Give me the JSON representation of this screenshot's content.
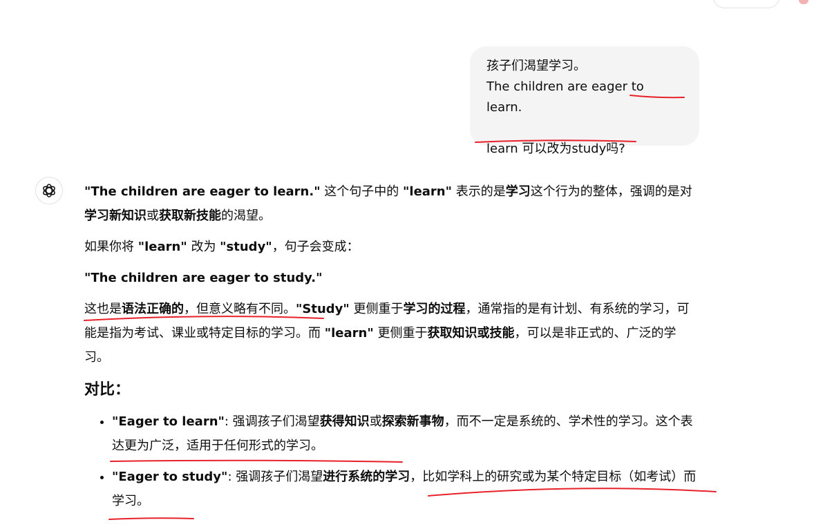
{
  "user_message": {
    "line1": "孩子们渴望学习。",
    "line2": "The children are eager to learn.",
    "line3": "learn 可以改为study吗?"
  },
  "answer": {
    "p1": {
      "s1": "\"The children are eager to learn.\"",
      "s2": " 这个句子中的 ",
      "s3": "\"learn\"",
      "s4": " 表示的是",
      "s5": "学习",
      "s6": "这个行为的整体，强调的是对",
      "s7": "学习新知识",
      "s8": "或",
      "s9": "获取新技能",
      "s10": "的渴望。"
    },
    "p2": {
      "s1": "如果你将 ",
      "s2": "\"learn\"",
      "s3": " 改为 ",
      "s4": "\"study\"",
      "s5": "，句子会变成："
    },
    "p3": "\"The children are eager to study.\"",
    "p4": {
      "s1": "这也是",
      "s2": "语法正确的",
      "s3": "，但意义略有不同。",
      "s4": "\"Study\"",
      "s5": " 更侧重于",
      "s6": "学习的过程",
      "s7": "，通常指的是有计划、有系统的学习，可能是指为考试、课业或特定目标的学习。而 ",
      "s8": "\"learn\"",
      "s9": " 更侧重于",
      "s10": "获取知识或技能",
      "s11": "，可以是非正式的、广泛的学习。"
    },
    "heading": "对比：",
    "bullets": [
      {
        "s1": "\"Eager to learn\"",
        "s2": ": 强调孩子们渴望",
        "s3": "获得知识",
        "s4": "或",
        "s5": "探索新事物",
        "s6": "，而不一定是系统的、学术性的学习。这个表达更为广泛，适用于任何形式的学习。"
      },
      {
        "s1": "\"Eager to study\"",
        "s2": ": 强调孩子们渴望",
        "s3": "进行系统的学习",
        "s4": "，比如学科上的研究或为某个特定目标（如考试）而学习。"
      }
    ]
  },
  "colors": {
    "annotation": "#e8202a",
    "bubble": "#f4f4f4",
    "text": "#0d0d0d"
  },
  "icons": {
    "assistant": "openai-logo-icon"
  }
}
